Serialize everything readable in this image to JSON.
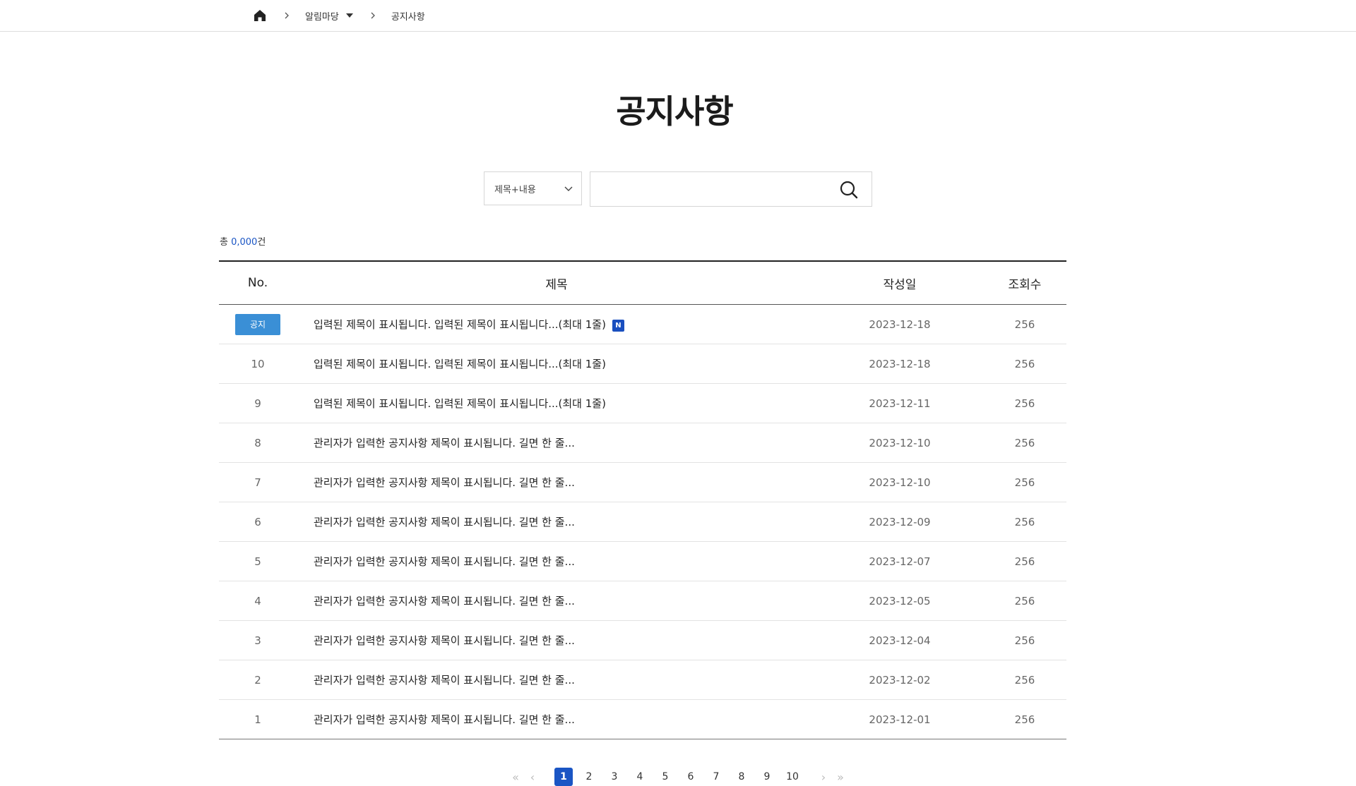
{
  "breadcrumb": {
    "items": [
      {
        "label": "알림마당",
        "has_dropdown": true
      },
      {
        "label": "공지사항",
        "has_dropdown": false
      }
    ]
  },
  "page_title": "공지사항",
  "search": {
    "select_value": "제목+내용",
    "input_value": "",
    "placeholder": ""
  },
  "total": {
    "prefix": "총 ",
    "count": "0,000",
    "suffix": "건"
  },
  "table": {
    "headers": [
      "No.",
      "제목",
      "작성일",
      "조회수"
    ],
    "rows": [
      {
        "no": "공지",
        "is_notice": true,
        "title": "입력된 제목이 표시됩니다. 입력된 제목이 표시됩니다...(최대 1줄)",
        "is_new": true,
        "new_label": "N",
        "date": "2023-12-18",
        "views": "256"
      },
      {
        "no": "10",
        "is_notice": false,
        "title": "입력된 제목이 표시됩니다. 입력된 제목이 표시됩니다...(최대 1줄)",
        "is_new": false,
        "date": "2023-12-18",
        "views": "256"
      },
      {
        "no": "9",
        "is_notice": false,
        "title": "입력된 제목이 표시됩니다. 입력된 제목이 표시됩니다...(최대 1줄)",
        "is_new": false,
        "date": "2023-12-11",
        "views": "256"
      },
      {
        "no": "8",
        "is_notice": false,
        "title": "관리자가 입력한 공지사항 제목이 표시됩니다. 길면 한 줄...",
        "is_new": false,
        "date": "2023-12-10",
        "views": "256"
      },
      {
        "no": "7",
        "is_notice": false,
        "title": "관리자가 입력한 공지사항 제목이 표시됩니다. 길면 한 줄...",
        "is_new": false,
        "date": "2023-12-10",
        "views": "256"
      },
      {
        "no": "6",
        "is_notice": false,
        "title": "관리자가 입력한 공지사항 제목이 표시됩니다. 길면 한 줄...",
        "is_new": false,
        "date": "2023-12-09",
        "views": "256"
      },
      {
        "no": "5",
        "is_notice": false,
        "title": "관리자가 입력한 공지사항 제목이 표시됩니다. 길면 한 줄...",
        "is_new": false,
        "date": "2023-12-07",
        "views": "256"
      },
      {
        "no": "4",
        "is_notice": false,
        "title": "관리자가 입력한 공지사항 제목이 표시됩니다. 길면 한 줄...",
        "is_new": false,
        "date": "2023-12-05",
        "views": "256"
      },
      {
        "no": "3",
        "is_notice": false,
        "title": "관리자가 입력한 공지사항 제목이 표시됩니다. 길면 한 줄...",
        "is_new": false,
        "date": "2023-12-04",
        "views": "256"
      },
      {
        "no": "2",
        "is_notice": false,
        "title": "관리자가 입력한 공지사항 제목이 표시됩니다. 길면 한 줄...",
        "is_new": false,
        "date": "2023-12-02",
        "views": "256"
      },
      {
        "no": "1",
        "is_notice": false,
        "title": "관리자가 입력한 공지사항 제목이 표시됩니다. 길면 한 줄...",
        "is_new": false,
        "date": "2023-12-01",
        "views": "256"
      }
    ]
  },
  "pagination": {
    "pages": [
      "1",
      "2",
      "3",
      "4",
      "5",
      "6",
      "7",
      "8",
      "9",
      "10"
    ],
    "current": "1",
    "first_icon": "double-chevron-left-icon",
    "prev_icon": "chevron-left-icon",
    "next_icon": "chevron-right-icon",
    "last_icon": "double-chevron-right-icon"
  },
  "colors": {
    "accent": "#1a55c4",
    "notice_badge": "#3a8fd6",
    "new_badge": "#1a4fbf"
  }
}
